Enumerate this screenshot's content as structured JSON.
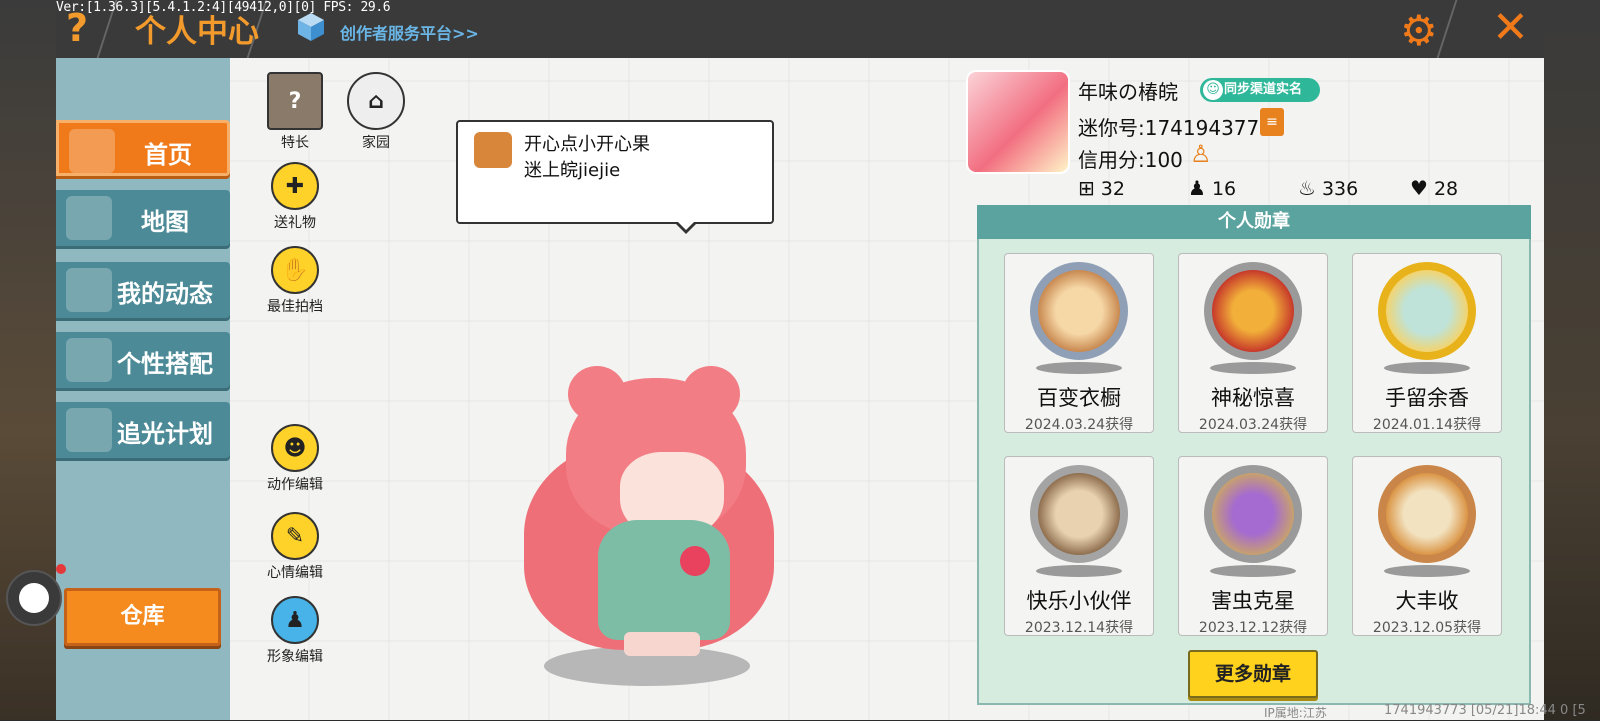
{
  "debug": {
    "version_text": "Ver:[1.36.3][5.4.1.2:4][49412,0][0] FPS: 29.6"
  },
  "header": {
    "title": "个人中心",
    "creator_link": "创作者服务平台>>",
    "help_icon": "question-mark-icon",
    "settings_icon": "gear-icon",
    "close_icon": "close-icon"
  },
  "sidebar": {
    "items": [
      {
        "label": "首页",
        "icon": "house-icon",
        "active": true
      },
      {
        "label": "地图",
        "icon": "map-icon",
        "active": false
      },
      {
        "label": "我的动态",
        "icon": "bell-icon",
        "active": false
      },
      {
        "label": "个性搭配",
        "icon": "outfit-icon",
        "active": false
      },
      {
        "label": "追光计划",
        "icon": "light-plan-icon",
        "active": false
      }
    ],
    "warehouse_label": "仓库"
  },
  "tools": {
    "specialty": "特长",
    "home": "家园",
    "send_gift": "送礼物",
    "best_partner": "最佳拍档",
    "action_edit": "动作编辑",
    "mood_edit": "心情编辑",
    "avatar_edit": "形象编辑"
  },
  "speech_bubble": {
    "line1": "开心点小开心果",
    "line2": "迷上皖jiejie"
  },
  "profile": {
    "nickname": "年味の椿皖",
    "sync_badge": "同步渠道实名",
    "uid_text": "迷你号:1741943773",
    "credit_text": "信用分:100",
    "stats": {
      "posts": "32",
      "fans": "16",
      "popularity": "336",
      "likes": "28"
    }
  },
  "badges": {
    "header": "个人勋章",
    "items": [
      {
        "name": "百变衣橱",
        "date": "2024.03.24获得",
        "color": "#8fa0b6"
      },
      {
        "name": "神秘惊喜",
        "date": "2024.03.24获得",
        "color": "#9a9a9a"
      },
      {
        "name": "手留余香",
        "date": "2024.01.14获得",
        "color": "#e7b21a"
      },
      {
        "name": "快乐小伙伴",
        "date": "2023.12.14获得",
        "color": "#a4a4a4"
      },
      {
        "name": "害虫克星",
        "date": "2023.12.12获得",
        "color": "#9a9a9a"
      },
      {
        "name": "大丰收",
        "date": "2023.12.05获得",
        "color": "#c98648"
      }
    ],
    "more_label": "更多勋章"
  },
  "footer": {
    "ip_text": "IP属地:江苏",
    "info_text": "1741943773    [05/21]18:44 0  [5"
  },
  "colors": {
    "accent_orange": "#f07a1a",
    "sidebar_teal": "#4b8a96",
    "badge_header": "#5aa39e",
    "more_button": "#ffd21e"
  }
}
